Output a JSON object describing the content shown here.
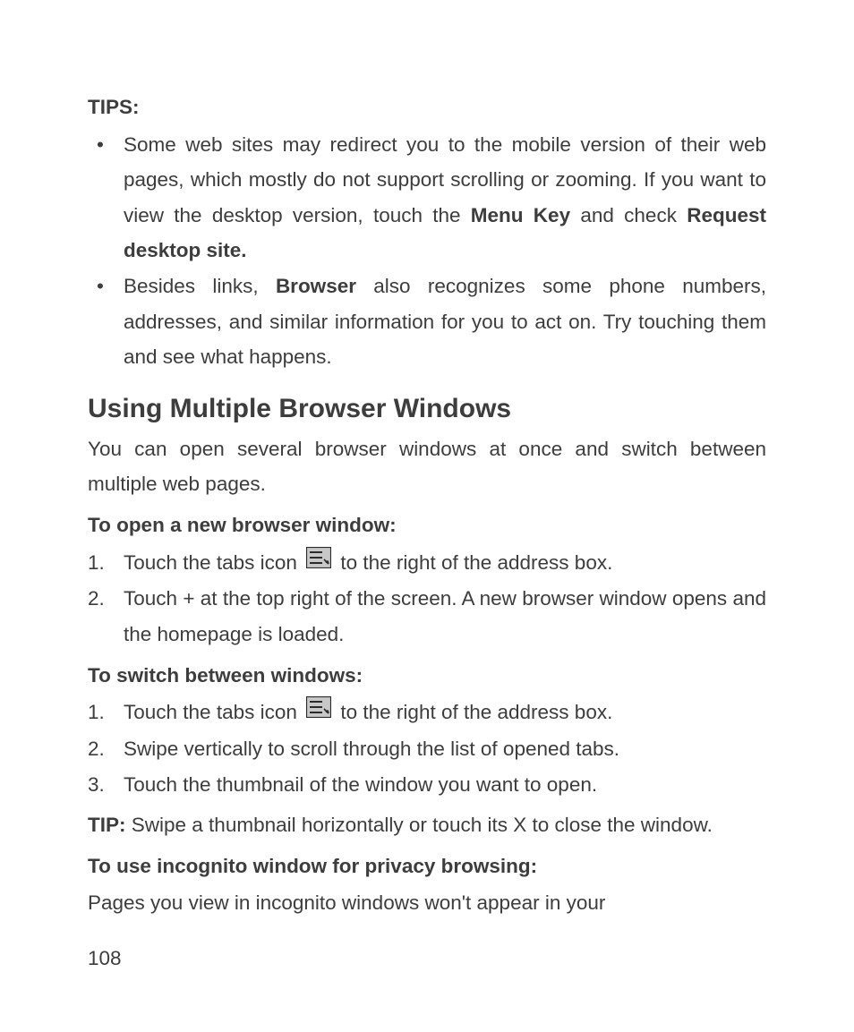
{
  "tips": {
    "label": "TIPS:",
    "items": [
      {
        "pre": "Some web sites may redirect you to the mobile version of their web pages, which mostly do not support scrolling or zooming. If you want to view the desktop version, touch the ",
        "bold1": "Menu Key",
        "mid": " and check ",
        "bold2": "Request desktop site."
      },
      {
        "pre": "Besides links, ",
        "bold1": "Browser",
        "post": " also recognizes some phone numbers, addresses, and similar information for you to act on. Try touching them and see what happens."
      }
    ]
  },
  "heading": "Using Multiple Browser Windows",
  "intro": "You can open several browser windows at once and switch between multiple web pages.",
  "open": {
    "label": "To open a new browser window:",
    "steps": [
      {
        "n": "1.",
        "pre": "Touch the tabs icon ",
        "icon": true,
        "post": " to the right of the address box."
      },
      {
        "n": "2.",
        "text": "Touch + at the top right of the screen. A new browser window opens and the homepage is loaded."
      }
    ]
  },
  "switch": {
    "label": "To switch between windows:",
    "steps": [
      {
        "n": "1.",
        "pre": "Touch the tabs icon ",
        "icon": true,
        "post": " to the right of the address box."
      },
      {
        "n": "2.",
        "text": "Swipe vertically to scroll through the list of opened tabs."
      },
      {
        "n": "3.",
        "text": "Touch the thumbnail of the window you want to open."
      }
    ]
  },
  "tip2": {
    "label": "TIP:",
    "text": " Swipe a thumbnail horizontally or touch its X to close the window."
  },
  "incognito": {
    "label": "To use incognito window for privacy browsing:",
    "text": "Pages you view in incognito windows won't appear in your"
  },
  "pageNumber": "108"
}
